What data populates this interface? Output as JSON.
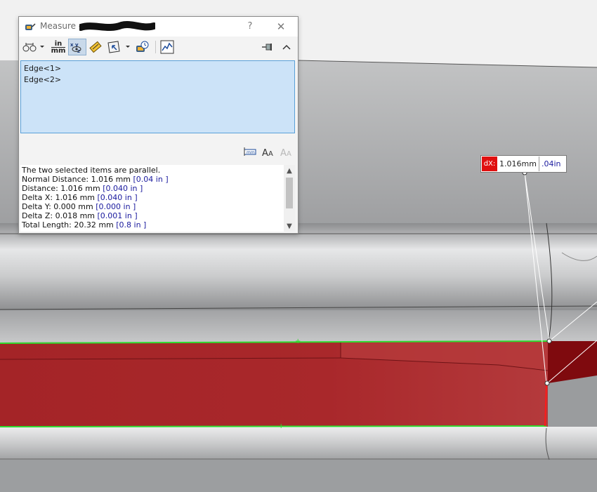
{
  "dialog": {
    "title": "Measure - ",
    "help_label": "?",
    "close_label": "✕"
  },
  "toolbar": {
    "units_top": "in",
    "units_bottom": "mm"
  },
  "selection": {
    "items": [
      "Edge<1>",
      "Edge<2>"
    ]
  },
  "results": {
    "lines": [
      {
        "label": "The two selected items are parallel.",
        "alt": ""
      },
      {
        "label": "Normal Distance: 1.016 mm",
        "alt": "[0.04 in ]"
      },
      {
        "label": "Distance: 1.016 mm",
        "alt": "[0.040 in ]"
      },
      {
        "label": "Delta X: 1.016 mm",
        "alt": "[0.040 in ]"
      },
      {
        "label": "Delta Y: 0.000 mm",
        "alt": "[0.000 in ]"
      },
      {
        "label": "Delta Z: 0.018 mm",
        "alt": "[0.001 in ]"
      },
      {
        "label": "Total Length: 20.32 mm",
        "alt": "[0.8 in ]"
      }
    ]
  },
  "callout": {
    "label": "dX:",
    "value": "1.016mm",
    "alt_value": ".04in"
  },
  "colors": {
    "face_red": "#a42427",
    "edge_green": "#2fdc2f",
    "callout_red": "#e01010"
  },
  "icons": [
    "measure-app-icon",
    "arc-condition-icon",
    "units-icon",
    "show-xyz-icon",
    "point-to-point-icon",
    "projection-icon",
    "measurement-history-icon",
    "sensor-icon",
    "pin-icon",
    "collapse-icon",
    "dimension-icon",
    "text-size-increase-icon",
    "text-size-decrease-icon"
  ]
}
